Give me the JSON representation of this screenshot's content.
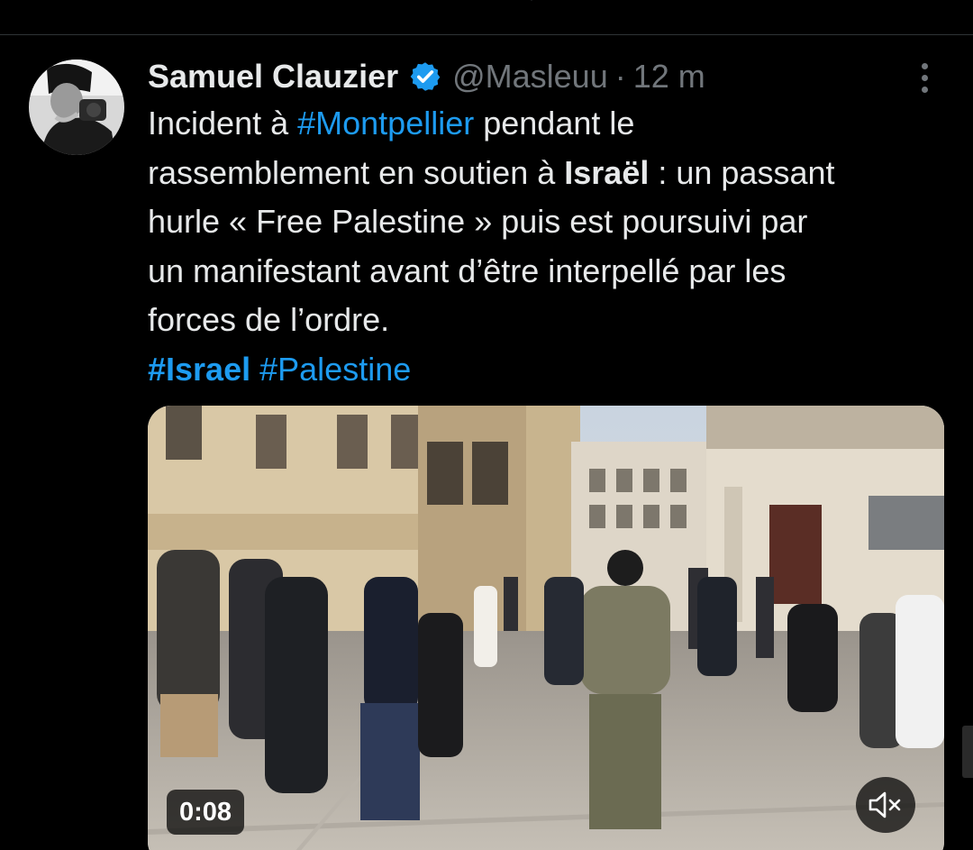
{
  "tweet": {
    "author": {
      "display_name": "Samuel Clauzier",
      "handle": "@Masleuu",
      "verified": true
    },
    "separator": "·",
    "time": "12 m",
    "text_lines": [
      [
        {
          "t": "Incident à "
        },
        {
          "t": "#Montpellier",
          "tag": true
        },
        {
          "t": " pendant le"
        }
      ],
      [
        {
          "t": "rassemblement en soutien à "
        },
        {
          "t": "Israël",
          "bold": true
        },
        {
          "t": " : un passant"
        }
      ],
      [
        {
          "t": "hurle « Free Palestine » puis est poursuivi par"
        }
      ],
      [
        {
          "t": "un manifestant avant d’être interpellé par les"
        }
      ],
      [
        {
          "t": "forces de l’ordre."
        }
      ],
      [
        {
          "t": "#Israel",
          "tag": true,
          "bold": true
        },
        {
          "t": " "
        },
        {
          "t": "#Palestine",
          "tag": true
        }
      ]
    ],
    "media": {
      "type": "video",
      "duration": "0:08"
    }
  },
  "icons": {
    "verified": "verified-badge-icon",
    "more": "more-options-icon",
    "mute": "volume-muted-icon"
  },
  "colors": {
    "background": "#000000",
    "text": "#e7e9ea",
    "secondary": "#71767b",
    "accent": "#1d9bf0"
  }
}
